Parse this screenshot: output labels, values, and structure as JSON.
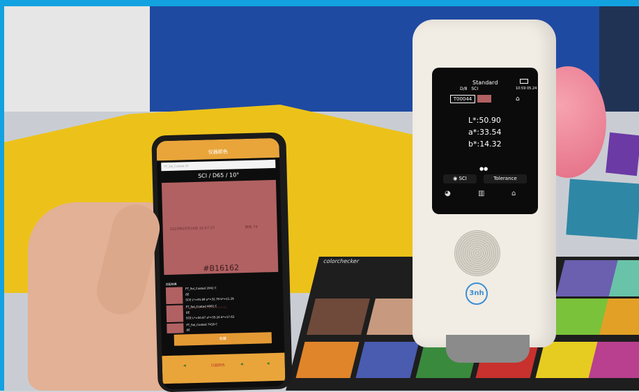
{
  "device": {
    "title": "Standard",
    "mode_row": "D/8 SCI",
    "time": "10:59 05.24",
    "sample_id": "T00044",
    "lab": [
      "L*:50.90",
      "a*:33.54",
      "b*:14.32"
    ],
    "left_button": "SCI",
    "right_button": "Tolerance",
    "brand_short": "3nh",
    "icons": [
      "battery-icon",
      "camera-icon",
      "palette-icon",
      "trash-icon",
      "home-icon"
    ],
    "swatch_color": "#B16162"
  },
  "phone": {
    "title": "仪器颜色",
    "dropdown": "PT_Sol_Coated 2C",
    "mode": "SCI / D65 / 10°",
    "color_hex": "#B16162",
    "color_value": "#B16162",
    "meta_left": "2023年05月24日 10:57:37",
    "meta_right": "颜色 74",
    "lab_line": "L*=50.97  a*=33.57  b*=14.31",
    "section_title": "匹配结果",
    "results": [
      {
        "name": "PT_Sol_Coated 2042 C",
        "de": "ΔE",
        "detail": "SCE  L*=45.89  a*=32.79  b*=11.29"
      },
      {
        "name": "PT_Sol_Coated 4061 C",
        "de": "ΔE",
        "detail": "SCE  L*=50.67  a*=35.24  b*=17.63"
      },
      {
        "name": "PT_Sol_Coated 7418 C",
        "de": "ΔE",
        "detail": ""
      }
    ],
    "button": "收藏",
    "nav": [
      "",
      "仪器颜色",
      "",
      ""
    ]
  },
  "scene": {
    "checker_label": "colorchecker",
    "colors": {
      "frame": "#12A2E0",
      "yellow_cloth": "#ECC21A",
      "blue_board": "#1F4AA1",
      "phone_accent": "#E9A53A"
    }
  }
}
